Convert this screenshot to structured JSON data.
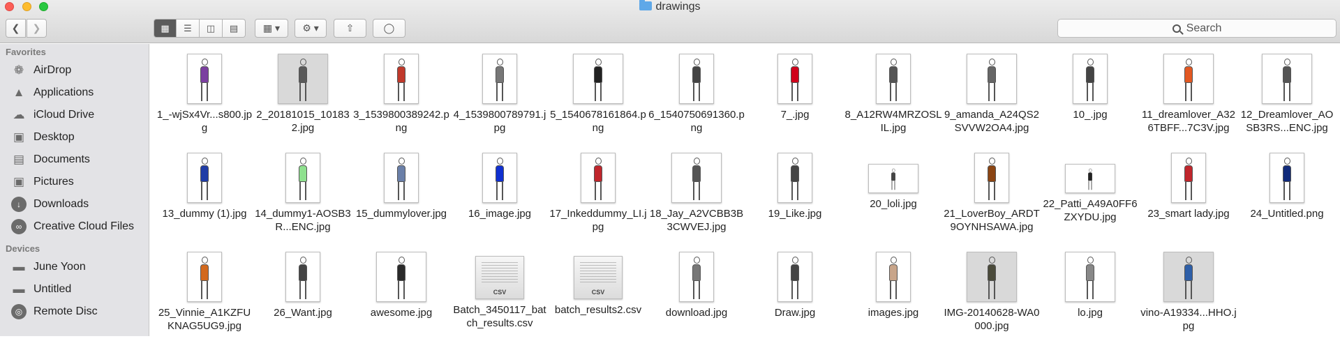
{
  "window": {
    "title": "drawings"
  },
  "search": {
    "label": "Search"
  },
  "sidebar": {
    "favorites_heading": "Favorites",
    "favorites": [
      {
        "label": "AirDrop",
        "icon": "airdrop-icon"
      },
      {
        "label": "Applications",
        "icon": "applications-icon"
      },
      {
        "label": "iCloud Drive",
        "icon": "icloud-icon"
      },
      {
        "label": "Desktop",
        "icon": "desktop-icon"
      },
      {
        "label": "Documents",
        "icon": "documents-icon"
      },
      {
        "label": "Pictures",
        "icon": "pictures-icon"
      },
      {
        "label": "Downloads",
        "icon": "downloads-icon"
      },
      {
        "label": "Creative Cloud Files",
        "icon": "creative-cloud-icon"
      }
    ],
    "devices_heading": "Devices",
    "devices": [
      {
        "label": "June Yoon",
        "icon": "computer-icon"
      },
      {
        "label": "Untitled",
        "icon": "disk-icon"
      },
      {
        "label": "Remote Disc",
        "icon": "remote-disc-icon"
      }
    ]
  },
  "files": [
    {
      "name": "1_-wjSx4Vr...s800.jpg",
      "kind": "portrait",
      "accent": "#7b3fa0"
    },
    {
      "name": "2_20181015_101832.jpg",
      "kind": "square",
      "accent": "#5a5a5a"
    },
    {
      "name": "3_1539800389242.png",
      "kind": "portrait",
      "accent": "#c0392b"
    },
    {
      "name": "4_1539800789791.jpg",
      "kind": "portrait",
      "accent": "#777777"
    },
    {
      "name": "5_1540678161864.png",
      "kind": "square",
      "accent": "#222222"
    },
    {
      "name": "6_1540750691360.png",
      "kind": "portrait",
      "accent": "#444444"
    },
    {
      "name": "7_.jpg",
      "kind": "portrait",
      "accent": "#d0021b"
    },
    {
      "name": "8_A12RW4MRZOSLIL.jpg",
      "kind": "portrait",
      "accent": "#555555"
    },
    {
      "name": "9_amanda_A24QS2SVVW2OA4.jpg",
      "kind": "square",
      "accent": "#666666"
    },
    {
      "name": "10_.jpg",
      "kind": "portrait",
      "accent": "#444444"
    },
    {
      "name": "11_dreamlover_A326TBFF...7C3V.jpg",
      "kind": "square",
      "accent": "#e25822"
    },
    {
      "name": "12_Dreamlover_AOSB3RS...ENC.jpg",
      "kind": "square",
      "accent": "#555555"
    },
    {
      "name": "13_dummy (1).jpg",
      "kind": "portrait",
      "accent": "#1f3ca6"
    },
    {
      "name": "14_dummy1-AOSB3R...ENC.jpg",
      "kind": "portrait",
      "accent": "#8ee08e"
    },
    {
      "name": "15_dummylover.jpg",
      "kind": "portrait",
      "accent": "#6a7fa8"
    },
    {
      "name": "16_image.jpg",
      "kind": "portrait",
      "accent": "#1030d0"
    },
    {
      "name": "17_Inkeddummy_LI.jpg",
      "kind": "portrait",
      "accent": "#c0262c"
    },
    {
      "name": "18_Jay_A2VCBB3B3CWVEJ.jpg",
      "kind": "square",
      "accent": "#555555"
    },
    {
      "name": "19_Like.jpg",
      "kind": "portrait",
      "accent": "#444444"
    },
    {
      "name": "20_loli.jpg",
      "kind": "wide",
      "accent": "#444444"
    },
    {
      "name": "21_LoverBoy_ARDT9OYNHSAWA.jpg",
      "kind": "portrait",
      "accent": "#8b4513"
    },
    {
      "name": "22_Patti_A49A0FF6ZXYDU.jpg",
      "kind": "wide",
      "accent": "#222222"
    },
    {
      "name": "23_smart lady.jpg",
      "kind": "portrait",
      "accent": "#c0262c"
    },
    {
      "name": "24_Untitled.png",
      "kind": "portrait",
      "accent": "#102a7a"
    },
    {
      "name": "25_Vinnie_A1KZFUKNAG5UG9.jpg",
      "kind": "portrait",
      "accent": "#d2691e"
    },
    {
      "name": "26_Want.jpg",
      "kind": "portrait",
      "accent": "#444444"
    },
    {
      "name": "awesome.jpg",
      "kind": "square",
      "accent": "#2a2a2a"
    },
    {
      "name": "Batch_3450117_batch_results.csv",
      "kind": "csv",
      "badge": "CSV"
    },
    {
      "name": "batch_results2.csv",
      "kind": "csv",
      "badge": "CSV"
    },
    {
      "name": "download.jpg",
      "kind": "portrait",
      "accent": "#777777"
    },
    {
      "name": "Draw.jpg",
      "kind": "portrait",
      "accent": "#444444"
    },
    {
      "name": "images.jpg",
      "kind": "portrait",
      "accent": "#c8a58a"
    },
    {
      "name": "IMG-20140628-WA0000.jpg",
      "kind": "square",
      "accent": "#4a4a3a"
    },
    {
      "name": "lo.jpg",
      "kind": "square",
      "accent": "#888888"
    },
    {
      "name": "vino-A19334...HHO.jpg",
      "kind": "square",
      "accent": "#2e5fa8"
    }
  ]
}
